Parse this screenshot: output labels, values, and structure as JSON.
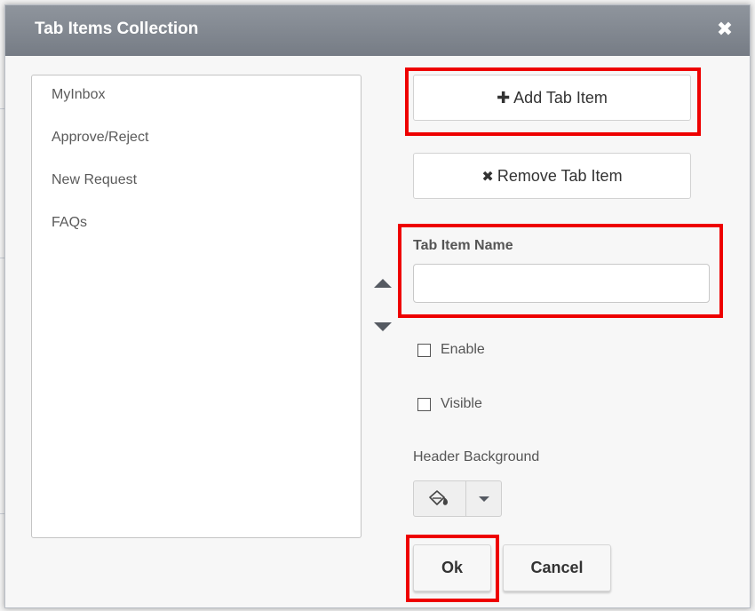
{
  "dialog": {
    "title": "Tab Items Collection",
    "close_symbol": "✖"
  },
  "tab_items": [
    {
      "label": "MyInbox"
    },
    {
      "label": "Approve/Reject"
    },
    {
      "label": "New Request"
    },
    {
      "label": "FAQs"
    }
  ],
  "actions": {
    "add": {
      "icon": "plus-icon",
      "glyph": "✚",
      "label": "Add Tab Item"
    },
    "remove": {
      "icon": "x-icon",
      "glyph": "✖",
      "label": "Remove Tab Item"
    }
  },
  "reorder": {
    "up_icon": "triangle-up-icon",
    "down_icon": "triangle-down-icon"
  },
  "properties": {
    "name_label": "Tab Item Name",
    "name_value": "",
    "enable_label": "Enable",
    "enable_checked": false,
    "visible_label": "Visible",
    "visible_checked": false,
    "header_background_label": "Header Background",
    "header_background_icon": "paint-bucket-icon"
  },
  "footer": {
    "ok_label": "Ok",
    "cancel_label": "Cancel"
  },
  "colors": {
    "highlight": "#ee0000",
    "titlebar": "#80868e"
  }
}
